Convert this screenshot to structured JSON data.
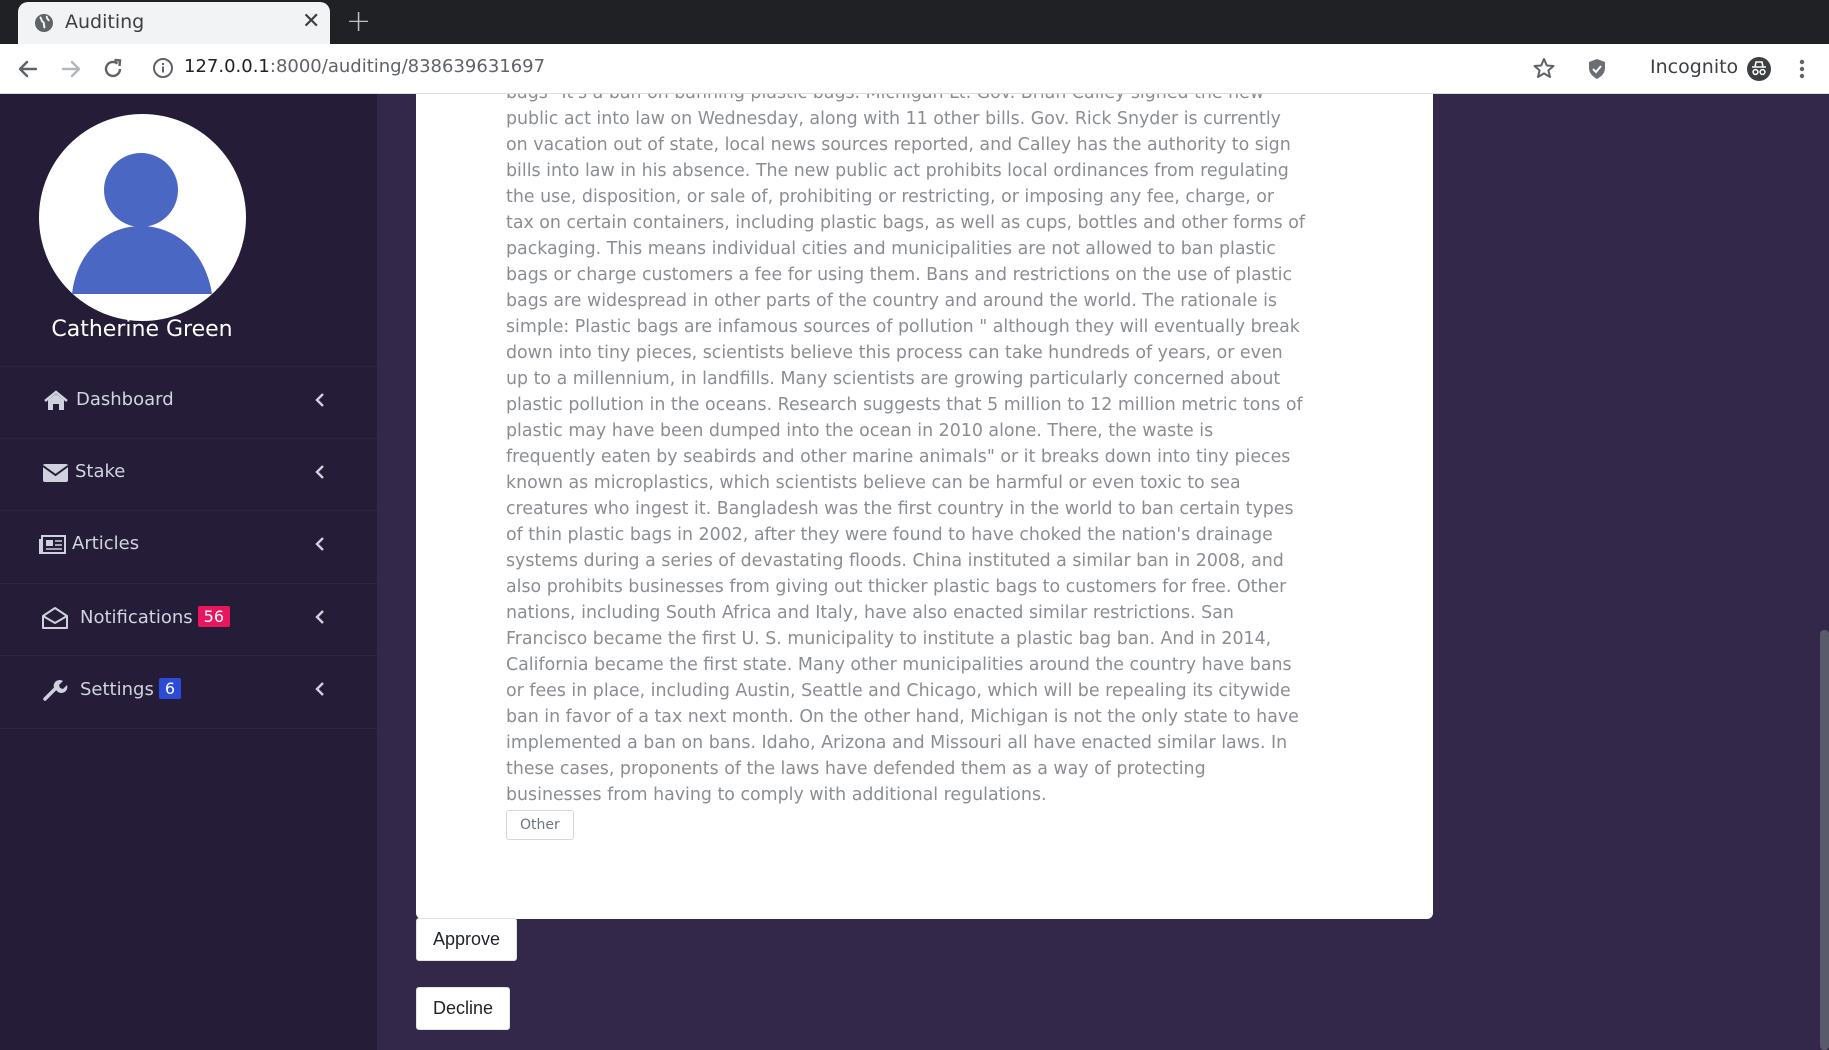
{
  "browser": {
    "tab_title": "Auditing",
    "url_host": "127.0.0.1",
    "url_rest": ":8000/auditing/838639631697",
    "incognito_label": "Incognito"
  },
  "sidebar": {
    "user_name": "Catherine Green",
    "items": [
      {
        "label": "Dashboard",
        "icon": "home-icon"
      },
      {
        "label": "Stake",
        "icon": "envelope-icon"
      },
      {
        "label": "Articles",
        "icon": "newspaper-icon"
      },
      {
        "label": "Notifications",
        "icon": "envelope-open-icon",
        "badge": "56",
        "badge_color": "#e8175d"
      },
      {
        "label": "Settings",
        "icon": "wrench-icon",
        "badge": "6",
        "badge_color": "#2c4bd8"
      }
    ]
  },
  "article": {
    "body": "bags\" It's a ban on banning plastic bags. Michigan Lt. Gov. Brian Calley signed the new public act into law on Wednesday, along with 11 other bills. Gov. Rick Snyder is currently on vacation out of state, local news sources reported, and Calley has the authority to sign bills into law in his absence. The new public act prohibits local ordinances from regulating the use, disposition, or sale of, prohibiting or restricting, or imposing any fee, charge, or tax on certain containers, including plastic bags, as well as cups, bottles and other forms of packaging. This means individual cities and municipalities are not allowed to ban plastic bags or charge customers a fee for using them. Bans and restrictions on the use of plastic bags are widespread in other parts of the country and around the world. The rationale is simple: Plastic bags are infamous sources of pollution \" although they will eventually break down into tiny pieces, scientists believe this process can take hundreds of years, or even up to a millennium, in landfills. Many scientists are growing particularly concerned about plastic pollution in the oceans. Research suggests that 5 million to 12 million metric tons of plastic may have been dumped into the ocean in 2010 alone. There, the waste is frequently eaten by seabirds and other marine animals\" or it breaks down into tiny pieces known as microplastics, which scientists believe can be harmful or even toxic to sea creatures who ingest it. Bangladesh was the first country in the world to ban certain types of thin plastic bags in 2002, after they were found to have choked the nation's drainage systems during a series of devastating floods. China instituted a similar ban in 2008, and also prohibits businesses from giving out thicker plastic bags to customers for free. Other nations, including South Africa and Italy, have also enacted similar restrictions. San Francisco became the first U. S. municipality to institute a plastic bag ban. And in 2014, California became the first state. Many other municipalities around the country have bans or fees in place, including Austin, Seattle and Chicago, which will be repealing its citywide ban in favor of a tax next month. On the other hand, Michigan is not the only state to have implemented a ban on bans. Idaho, Arizona and Missouri all have enacted similar laws. In these cases, proponents of the laws have defended them as a way of protecting businesses from having to comply with additional regulations.",
    "tag": "Other"
  },
  "actions": {
    "approve": "Approve",
    "decline": "Decline"
  },
  "colors": {
    "sidebar_bg": "#251d37",
    "page_bg": "#33284a",
    "avatar_fill": "#4a67c4"
  }
}
